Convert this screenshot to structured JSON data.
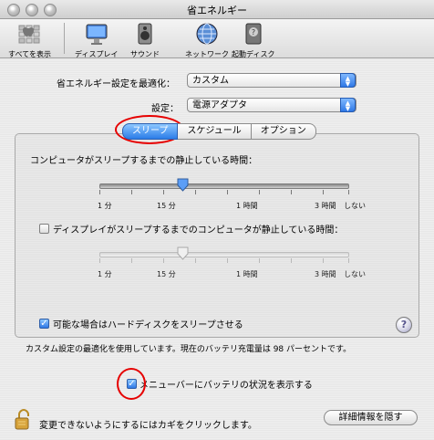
{
  "window": {
    "title": "省エネルギー"
  },
  "toolbar": {
    "items": [
      {
        "label": "すべてを表示",
        "icon": "apple-icon"
      },
      {
        "label": "ディスプレイ",
        "icon": "display-icon"
      },
      {
        "label": "サウンド",
        "icon": "speaker-icon"
      },
      {
        "label": "ネットワーク",
        "icon": "globe-icon"
      },
      {
        "label": "起動ディスク",
        "icon": "disk-icon"
      }
    ]
  },
  "optimize": {
    "label": "省エネルギー設定を最適化：",
    "value": "カスタム"
  },
  "setting": {
    "label": "設定：",
    "value": "電源アダプタ"
  },
  "tabs": [
    "スリープ",
    "スケジュール",
    "オプション"
  ],
  "sleep": {
    "computer_label": "コンピュータがスリープするまでの静止している時間：",
    "display_label": "ディスプレイがスリープするまでのコンピュータが静止している時間：",
    "scale": [
      "1 分",
      "15 分",
      "1 時間",
      "3 時間",
      "しない"
    ],
    "computer_minutes": 20,
    "display_minutes": 20,
    "disk_sleep_label": "可能な場合はハードディスクをスリープさせる",
    "disk_sleep_checked": true,
    "display_checked": false
  },
  "status": "カスタム設定の最適化を使用しています。現在のバッテリ充電量は 98 パーセントです。",
  "menu_battery": {
    "label": "メニューバーにバッテリの状況を表示する",
    "checked": true
  },
  "lock_text": "変更できないようにするにはカギをクリックします。",
  "details_button": "詳細情報を隠す",
  "colors": {
    "accent": "#2f79e6",
    "annotation": "#e60000"
  }
}
